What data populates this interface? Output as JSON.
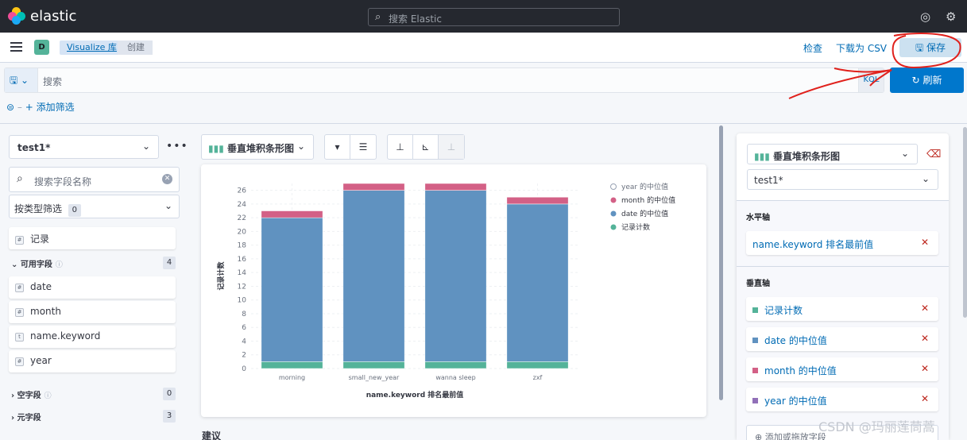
{
  "app": {
    "logo_text": "elastic",
    "search_placeholder": "搜索 Elastic"
  },
  "breadcrumb": {
    "space_avatar": "D",
    "items": [
      "Visualize 库",
      "创建"
    ]
  },
  "top_actions": {
    "inspect": "检查",
    "download_csv": "下载为 CSV",
    "save": "保存"
  },
  "query": {
    "placeholder": "搜索",
    "language": "KQL",
    "refresh": "刷新",
    "add_filter": "+ 添加筛选"
  },
  "sidebar": {
    "index_pattern": "test1*",
    "field_search_placeholder": "搜索字段名称",
    "filter_by_type": "按类型筛选",
    "filter_by_type_count": "0",
    "records_label": "记录",
    "available_fields_title": "可用字段",
    "available_fields_count": "4",
    "fields": [
      {
        "name": "date",
        "type": "#"
      },
      {
        "name": "month",
        "type": "#"
      },
      {
        "name": "name.keyword",
        "type": "t"
      },
      {
        "name": "year",
        "type": "#"
      }
    ],
    "empty_fields_title": "空字段",
    "empty_fields_count": "0",
    "meta_fields_title": "元字段",
    "meta_fields_count": "3"
  },
  "workspace": {
    "vis_type": "垂直堆积条形图",
    "suggestions_title": "建议"
  },
  "chart_data": {
    "type": "bar",
    "stacked": true,
    "title": "",
    "xlabel": "name.keyword 排名最前值",
    "ylabel": "记录计数",
    "ylim": [
      0,
      27
    ],
    "yticks": [
      0,
      2,
      4,
      6,
      8,
      10,
      12,
      14,
      16,
      18,
      20,
      22,
      24,
      26
    ],
    "categories": [
      "morning",
      "small_new_year",
      "wanna sleep",
      "zxf"
    ],
    "series": [
      {
        "name": "记录计数",
        "color": "#54b399",
        "values": [
          1,
          1,
          1,
          1
        ]
      },
      {
        "name": "date 的中位值",
        "color": "#6092c0",
        "values": [
          21,
          25,
          25,
          23
        ]
      },
      {
        "name": "month 的中位值",
        "color": "#d36086",
        "values": [
          1,
          1,
          1,
          1
        ]
      },
      {
        "name": "year 的中位值",
        "color": "#9170b8",
        "values": [
          0,
          0,
          0,
          0
        ],
        "hidden": true
      }
    ],
    "legend": [
      {
        "name": "year 的中位值",
        "hidden": true
      },
      {
        "name": "month 的中位值",
        "color": "#d36086"
      },
      {
        "name": "date 的中位值",
        "color": "#6092c0"
      },
      {
        "name": "记录计数",
        "color": "#54b399"
      }
    ],
    "legend_position": "top-right",
    "grid": true
  },
  "config_panel": {
    "vis_type": "垂直堆积条形图",
    "layer_index": "test1*",
    "horizontal_axis_title": "水平轴",
    "horizontal_axis_field": "name.keyword 排名最前值",
    "vertical_axis_title": "垂直轴",
    "vertical_axis_fields": [
      {
        "label": "记录计数",
        "color": "#54b399"
      },
      {
        "label": "date 的中位值",
        "color": "#6092c0"
      },
      {
        "label": "month 的中位值",
        "color": "#d36086"
      },
      {
        "label": "year 的中位值",
        "color": "#9170b8"
      }
    ],
    "add_field": "添加或拖放字段"
  },
  "watermark": "CSDN @玛丽莲茼蒿"
}
